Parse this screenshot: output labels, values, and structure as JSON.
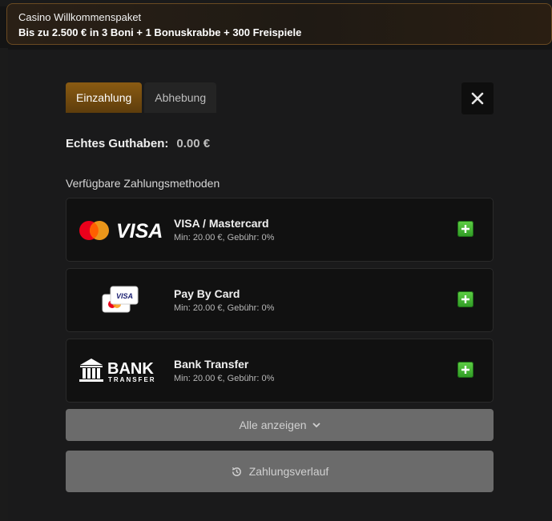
{
  "promo": {
    "title": "Casino Willkommenspaket",
    "subtitle": "Bis zu 2.500 € in 3 Boni + 1 Bonuskrabbe + 300 Freispiele"
  },
  "tabs": [
    {
      "label": "Einzahlung",
      "active": true
    },
    {
      "label": "Abhebung",
      "active": false
    }
  ],
  "balance": {
    "label": "Echtes Guthaben:",
    "value": "0.00 €"
  },
  "methods_heading": "Verfügbare Zahlungsmethoden",
  "methods": [
    {
      "name": "VISA / Mastercard",
      "info": "Min: 20.00 €, Gebühr: 0%",
      "logo": "visa-mastercard-logo",
      "logo_text": "VISA"
    },
    {
      "name": "Pay By Card",
      "info": "Min: 20.00 €, Gebühr: 0%",
      "logo": "cards-logo",
      "logo_text": "VISA"
    },
    {
      "name": "Bank Transfer",
      "info": "Min: 20.00 €, Gebühr: 0%",
      "logo": "bank-transfer-logo",
      "logo_text": "BANK",
      "logo_subtext": "TRANSFER"
    }
  ],
  "show_all_label": "Alle anzeigen",
  "history_label": "Zahlungsverlauf",
  "colors": {
    "accent": "#8a5b12",
    "add_green": "#3fb32e",
    "button_gray": "#6b6b6b"
  }
}
